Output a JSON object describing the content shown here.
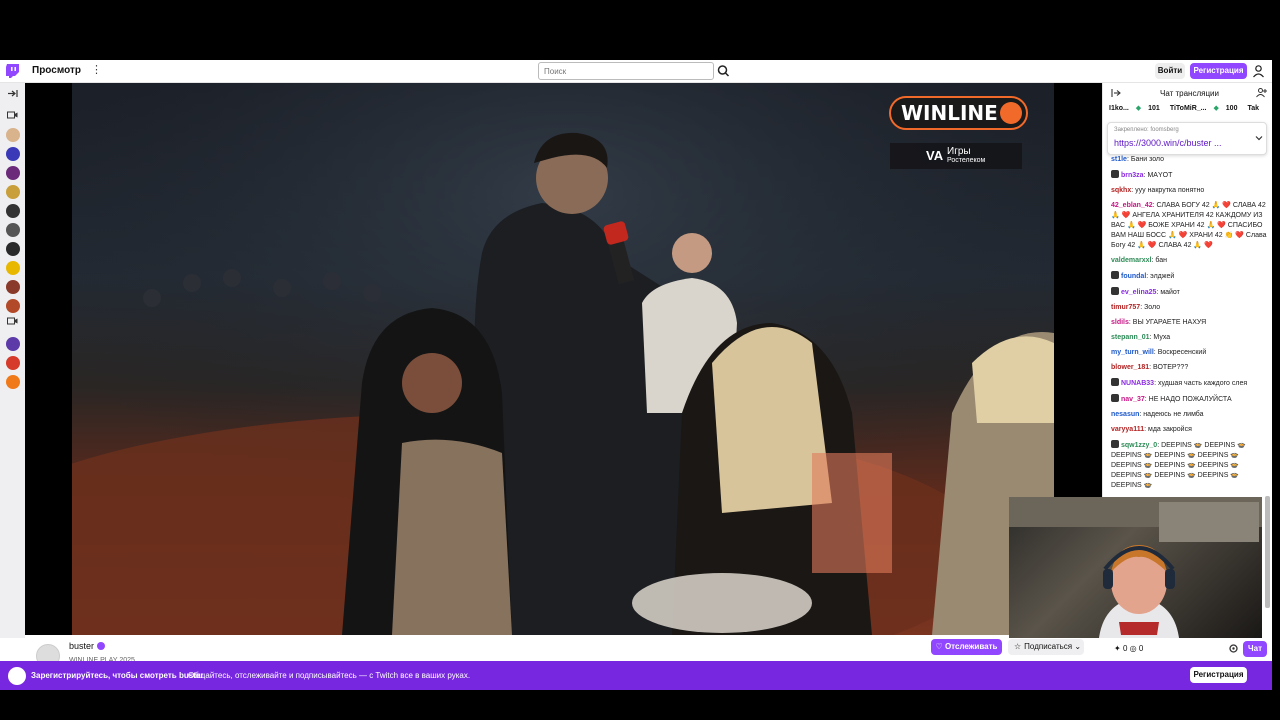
{
  "topnav": {
    "browse_label": "Просмотр",
    "more_label": "⋮",
    "search_placeholder": "Поиск",
    "login_label": "Войти",
    "signup_label": "Регистрация"
  },
  "colors": {
    "brand": "#9147ff",
    "banner": "#7727e0",
    "winline_orange": "#f26a2a"
  },
  "rail": {
    "icons": [
      "expand-icon",
      "camera-icon"
    ],
    "avatar_colors": [
      "#d9b38c",
      "#3a3ab8",
      "#6b2b7a",
      "#c89f3a",
      "#333333",
      "#555555",
      "#2a2a2a",
      "#e8b800",
      "#8a3a2a",
      "#b24a2a",
      "#5c3aa8",
      "#d63a2a",
      "#f07a1a"
    ]
  },
  "video": {
    "overlay_brand": "WINLINE",
    "overlay_partner_line1": "Игры",
    "overlay_partner_line2": "Ростелеком",
    "overlay_partner_mark": "VA"
  },
  "streamer": {
    "name": "buster",
    "subtitle": "WINLINE PLAY 2025",
    "follow_label": "Отслеживать",
    "subscribe_label": "Подписаться"
  },
  "chat": {
    "title": "Чат трансляции",
    "gifts": [
      {
        "name": "I1ko...",
        "amount": "101"
      },
      {
        "name": "TiToMiR_...",
        "amount": "100"
      },
      {
        "name": "Tak",
        "amount": ""
      }
    ],
    "pinned_label": "Закреплено: foomsberg",
    "pinned_link": "https://3000.win/c/buster ...",
    "messages": [
      {
        "user": "st1le",
        "color": "#1e58c9",
        "text": "Бани золо",
        "badge": false
      },
      {
        "user": "brn3za",
        "color": "#8a2be2",
        "text": "МАYОТ",
        "badge": true
      },
      {
        "user": "sqkhx",
        "color": "#b22222",
        "text": "ууу накрутка понятно",
        "badge": false
      },
      {
        "user": "42_eblan_42",
        "color": "#c71585",
        "text": "СЛАВА БОГУ 42 🙏 ❤️ СЛАВА 42 🙏 ❤️ АНГЕЛА ХРАНИТЕЛЯ 42 КАЖДОМУ ИЗ ВАС 🙏 ❤️ БОЖЕ ХРАНИ 42 🙏 ❤️ СПАСИБО ВАМ НАШ БОСС 🙏 ❤️ ХРАНИ 42 👏 ❤️ Слава Богу 42 🙏 ❤️ СЛАВА 42 🙏 ❤️",
        "badge": false
      },
      {
        "user": "valdemarxxl",
        "color": "#2e8b57",
        "text": "бан",
        "badge": false
      },
      {
        "user": "foundal",
        "color": "#1e58c9",
        "text": "элджей",
        "badge": true
      },
      {
        "user": "ev_elina25",
        "color": "#8a2be2",
        "text": "майот",
        "badge": true
      },
      {
        "user": "timur757",
        "color": "#b22222",
        "text": "Золо",
        "badge": false
      },
      {
        "user": "sldils",
        "color": "#c71585",
        "text": "ВЫ УГАРАЕТЕ НАХУЯ",
        "badge": false
      },
      {
        "user": "stepann_01",
        "color": "#2e8b57",
        "text": "Муха",
        "badge": false
      },
      {
        "user": "my_turn_will",
        "color": "#1e58c9",
        "text": "Воскресенский",
        "badge": false
      },
      {
        "user": "blower_181",
        "color": "#b22222",
        "text": "ВОТЕР???",
        "badge": false
      },
      {
        "user": "NUNAB33",
        "color": "#8a2be2",
        "text": "худшая часть каждого слея",
        "badge": true
      },
      {
        "user": "nav_37",
        "color": "#c71585",
        "text": "НЕ НАДО ПОЖАЛУЙСТА",
        "badge": true
      },
      {
        "user": "nesasun",
        "color": "#1e58c9",
        "text": "надеюсь не лимба",
        "badge": false
      },
      {
        "user": "varyya111",
        "color": "#b22222",
        "text": "мда закройся",
        "badge": false
      },
      {
        "user": "sqw1zzy_0",
        "color": "#2e8b57",
        "text": "DEEPINS 🍲 DEEPINS 🍲 DEEPINS 🍲 DEEPINS 🍲 DEEPINS 🍲 DEEPINS 🍲 DEEPINS 🍲 DEEPINS 🍲 DEEPINS 🍲 DEEPINS 🍲 DEEPINS 🍲 DEEPINS 🍲",
        "badge": true
      }
    ],
    "points_count": "0",
    "bits_count": "0",
    "chat_button": "Чат"
  },
  "banner": {
    "title": "Зарегистрируйтесь, чтобы смотреть buster",
    "text": "Общайтесь, отслеживайте и подписывайтесь — с Twitch все в ваших руках.",
    "button": "Регистрация"
  }
}
